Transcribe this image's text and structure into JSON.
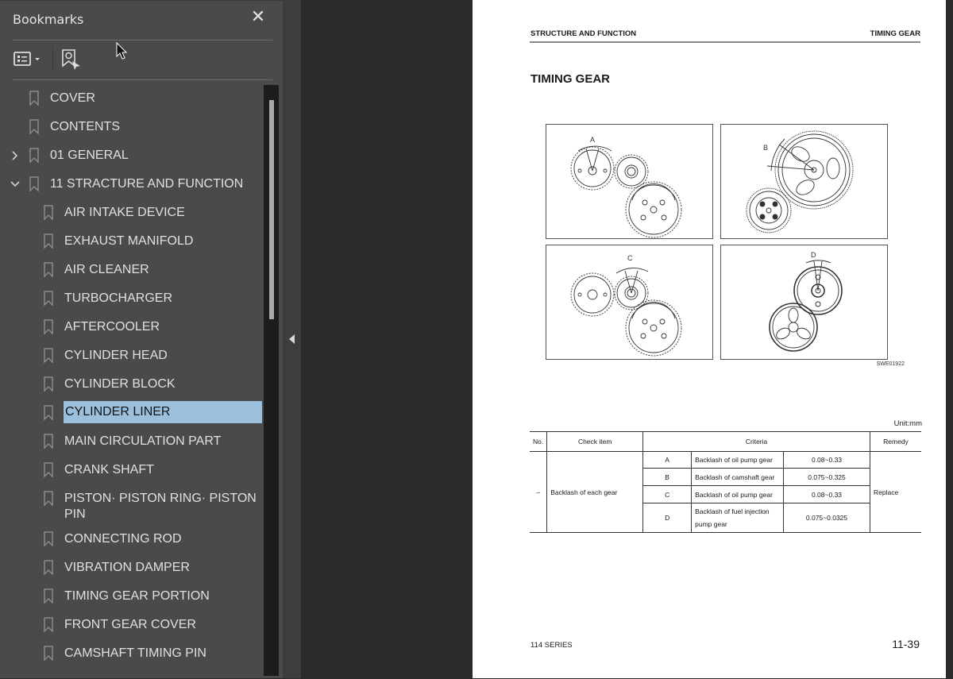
{
  "sidebar": {
    "title": "Bookmarks",
    "close_icon": "close-icon",
    "toolbar": {
      "options_icon": "list-options-icon",
      "find_icon": "find-current-bookmark-icon"
    },
    "items": [
      {
        "label": "COVER",
        "level": 0,
        "expander": "none"
      },
      {
        "label": "CONTENTS",
        "level": 0,
        "expander": "none"
      },
      {
        "label": "01 GENERAL",
        "level": 0,
        "expander": "collapsed"
      },
      {
        "label": "11 STRACTURE AND FUNCTION",
        "level": 0,
        "expander": "expanded"
      },
      {
        "label": "AIR INTAKE DEVICE",
        "level": 1
      },
      {
        "label": "EXHAUST MANIFOLD",
        "level": 1
      },
      {
        "label": "AIR CLEANER",
        "level": 1
      },
      {
        "label": "TURBOCHARGER",
        "level": 1
      },
      {
        "label": "AFTERCOOLER",
        "level": 1
      },
      {
        "label": "CYLINDER HEAD",
        "level": 1
      },
      {
        "label": "CYLINDER BLOCK",
        "level": 1
      },
      {
        "label": "CYLINDER LINER",
        "level": 1,
        "selected": true
      },
      {
        "label": "MAIN CIRCULATION PART",
        "level": 1
      },
      {
        "label": "CRANK SHAFT",
        "level": 1
      },
      {
        "label": "PISTON· PISTON RING· PISTON PIN",
        "level": 1
      },
      {
        "label": "CONNECTING ROD",
        "level": 1
      },
      {
        "label": "VIBRATION DAMPER",
        "level": 1
      },
      {
        "label": "TIMING GEAR PORTION",
        "level": 1
      },
      {
        "label": "FRONT GEAR COVER",
        "level": 1
      },
      {
        "label": "CAMSHAFT TIMING PIN",
        "level": 1
      }
    ],
    "colors": {
      "selected_bg": "#9ac0de",
      "panel_bg": "#4a4a4a"
    }
  },
  "page": {
    "header_left": "STRUCTURE AND FUNCTION",
    "header_right": "TIMING GEAR",
    "title": "TIMING GEAR",
    "figure_labels": [
      "A",
      "B",
      "C",
      "D"
    ],
    "figure_code": "SWE01922",
    "unit": "Unit:mm",
    "table": {
      "headers": {
        "no": "No.",
        "check_item": "Check item",
        "criteria": "Criteria",
        "remedy": "Remedy"
      },
      "no": "–",
      "check_item": "Backlash of each gear",
      "remedy": "Replace",
      "rows": [
        {
          "key": "A",
          "item": "Backlash of oil pump gear",
          "value": "0.08~0.33"
        },
        {
          "key": "B",
          "item": "Backlash of camshaft gear",
          "value": "0.075~0.325"
        },
        {
          "key": "C",
          "item": "Backlash of oil pump gear",
          "value": "0.08~0.33"
        },
        {
          "key": "D",
          "item": "Backlash of fuel injection pump gear",
          "value": "0.075~0.0325"
        }
      ]
    },
    "footer_left": "114 SERIES",
    "page_number": "11-39"
  }
}
